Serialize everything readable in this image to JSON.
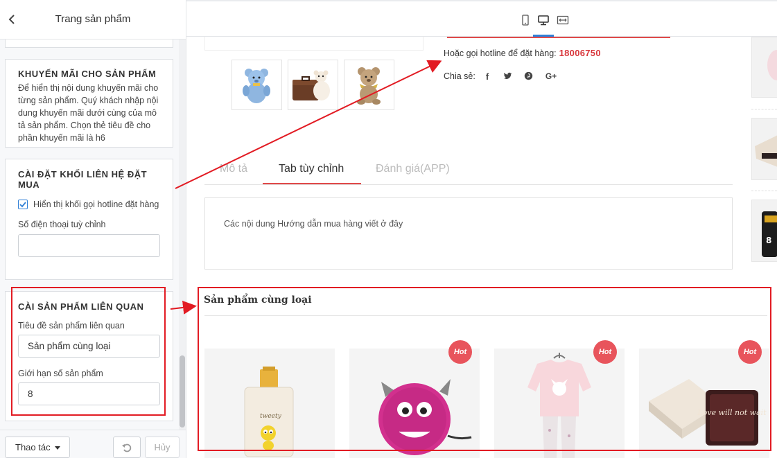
{
  "sidebar": {
    "title": "Trang sản phẩm",
    "promo": {
      "heading": "KHUYẾN MÃI CHO SẢN PHẨM",
      "description": "Để hiển thị nội dung khuyến mãi cho từng sản phẩm. Quý khách nhập nội dung khuyến mãi dưới cùng của mô tả sản phẩm. Chọn thẻ tiêu đề cho phần khuyến mãi là h6"
    },
    "contact": {
      "heading": "CÀI ĐẶT KHỐI LIÊN HỆ ĐẶT MUA",
      "checkbox_label": "Hiển thị khối gọi hotline đặt hàng",
      "checkbox_checked": true,
      "phone_label": "Số điện thoại tuỳ chỉnh",
      "phone_value": ""
    },
    "related": {
      "heading": "CÀI SẢN PHẨM LIÊN QUAN",
      "title_label": "Tiêu đề sản phẩm liên quan",
      "title_value": "Sản phẩm cùng loại",
      "limit_label": "Giới hạn số sản phẩm",
      "limit_value": "8"
    },
    "footer": {
      "actions_label": "Thao tác",
      "cancel_label": "Hủy"
    }
  },
  "preview": {
    "hotline_label": "Hoặc gọi hotline để đặt hàng:",
    "hotline_number": "18006750",
    "share_label": "Chia sẻ:",
    "share_icons": [
      "facebook-icon",
      "twitter-icon",
      "pinterest-icon",
      "google-plus-icon"
    ],
    "share_glyphs": [
      "f",
      "t",
      "p",
      "G+"
    ],
    "tabs": [
      {
        "label": "Mô tả",
        "active": false
      },
      {
        "label": "Tab tùy chỉnh",
        "active": true
      },
      {
        "label": "Đánh giá(APP)",
        "active": false
      }
    ],
    "tab_content": "Các nội dung Hướng dẫn mua hàng viết ở đây",
    "related_title": "Sản phẩm cùng loại",
    "badge_label": "Hot",
    "gift_box_text": "Love will not wait"
  },
  "colors": {
    "accent_red": "#e04a4a",
    "hotline_red": "#d8363b",
    "badge_pink": "#e8545c",
    "active_blue": "#2f7fd6",
    "annotation_red": "#e21b23"
  }
}
